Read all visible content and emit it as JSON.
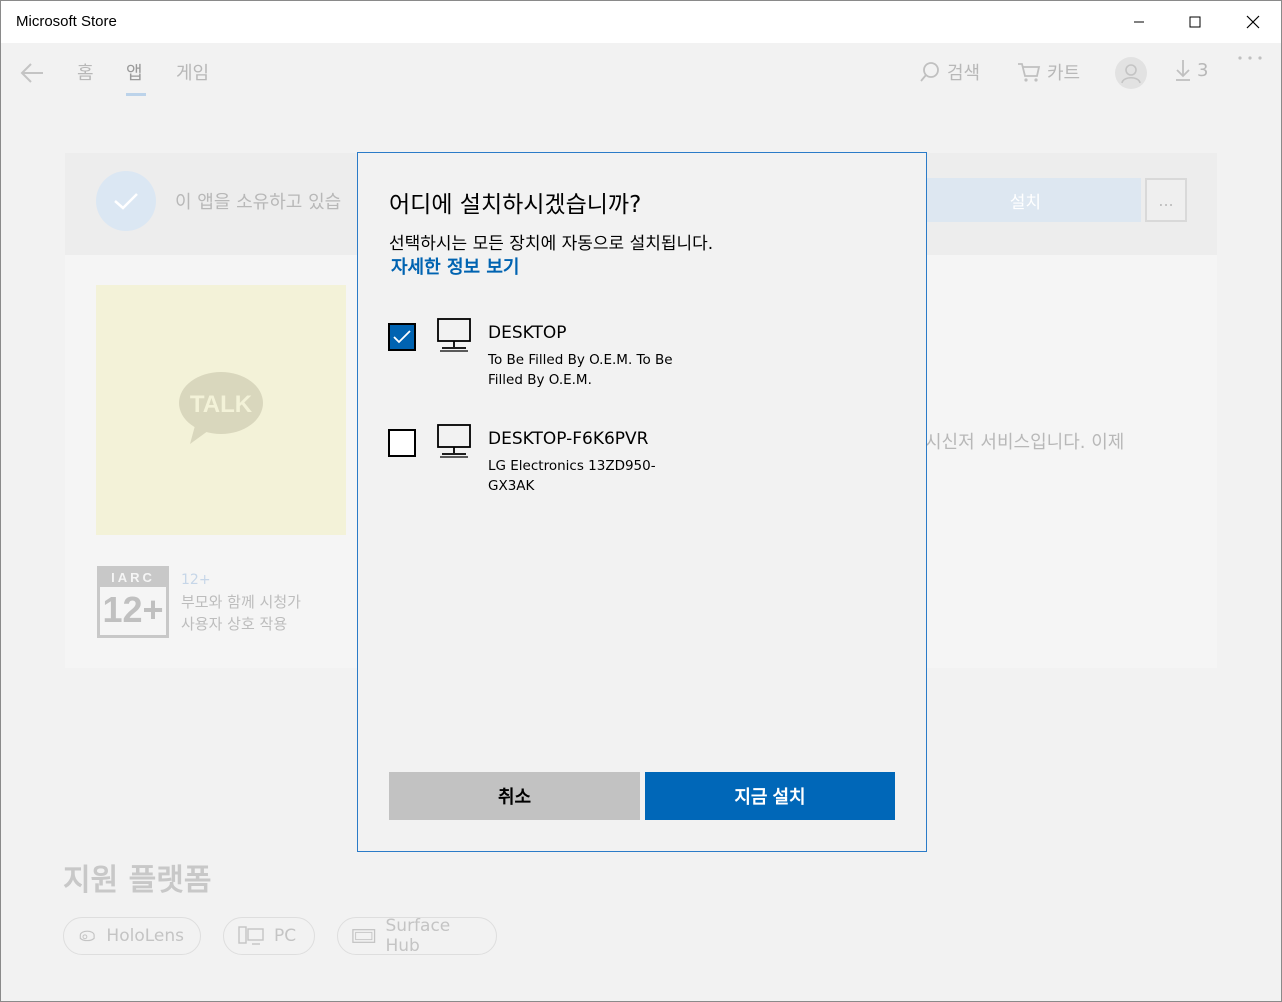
{
  "window": {
    "title": "Microsoft Store"
  },
  "nav": {
    "tabs": [
      {
        "label": "홈"
      },
      {
        "label": "앱"
      },
      {
        "label": "게임"
      }
    ],
    "search_label": "검색",
    "cart_label": "카트",
    "downloads_count": "3"
  },
  "app": {
    "owned_text": "이 앱을 소유하고 있습",
    "install_label": "설치",
    "more_label": "...",
    "logo_text": "TALK",
    "description_fragment": "시신저 서비스입니다. 이제",
    "rating": {
      "badge_header": "IARC",
      "badge_number": "12+",
      "age": "12+",
      "line1": "부모와 함께 시청가",
      "line2": "사용자 상호 작용"
    },
    "platforms_title": "지원 플랫폼",
    "platforms": [
      {
        "label": "HoloLens",
        "icon": "hololens-icon"
      },
      {
        "label": "PC",
        "icon": "pc-icon"
      },
      {
        "label": "Surface Hub",
        "icon": "surface-hub-icon"
      }
    ]
  },
  "dialog": {
    "title": "어디에 설치하시겠습니까?",
    "subtitle": "선택하시는 모든 장치에 자동으로 설치됩니다.",
    "details_link": "자세한 정보 보기",
    "devices": [
      {
        "name": "DESKTOP",
        "description": "To Be Filled By O.E.M. To Be Filled By O.E.M.",
        "checked": true,
        "icon": "desktop-pc-icon"
      },
      {
        "name": "DESKTOP-F6K6PVR",
        "description": "LG Electronics 13ZD950-GX3AK",
        "checked": false,
        "icon": "desktop-pc-icon"
      }
    ],
    "cancel_label": "취소",
    "install_now_label": "지금 설치"
  },
  "colors": {
    "accent": "#0067b8",
    "link": "#0063b1",
    "dialog_border": "#2b7bc8",
    "cancel_bg": "#c2c2c2"
  }
}
